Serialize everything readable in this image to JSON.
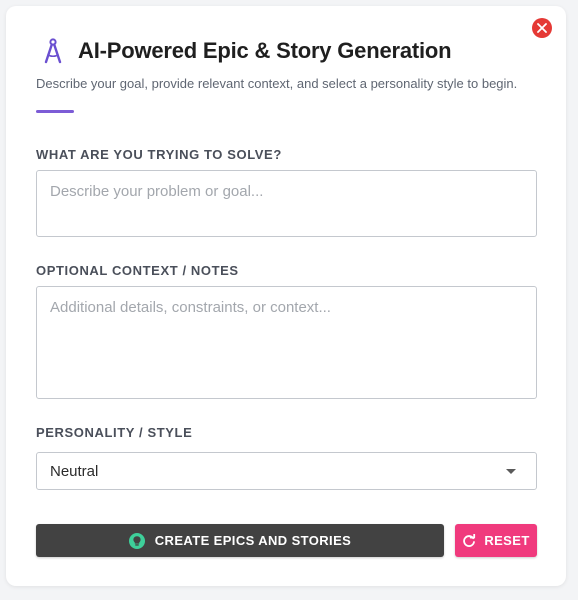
{
  "dialog": {
    "title": "AI-Powered Epic & Story Generation",
    "subtitle": "Describe your goal, provide relevant context, and select a personality style to begin.",
    "icons": {
      "header": "compass-drafting-icon",
      "close": "close-icon"
    }
  },
  "fields": {
    "problem": {
      "label": "WHAT ARE YOU TRYING TO SOLVE?",
      "value": "",
      "placeholder": "Describe your problem or goal..."
    },
    "context": {
      "label": "OPTIONAL CONTEXT / NOTES",
      "value": "",
      "placeholder": "Additional details, constraints, or context..."
    },
    "personality": {
      "label": "PERSONALITY / STYLE",
      "selected": "Neutral"
    }
  },
  "actions": {
    "create_label": "CREATE EPICS AND STORIES",
    "create_icon": "lightbulb-icon",
    "reset_label": "RESET",
    "reset_icon": "refresh-icon"
  },
  "colors": {
    "accent": "#7c5cd6",
    "close": "#e53935",
    "create_bg": "#424242",
    "create_icon": "#3ecf9a",
    "reset_bg": "#f03a7d"
  }
}
